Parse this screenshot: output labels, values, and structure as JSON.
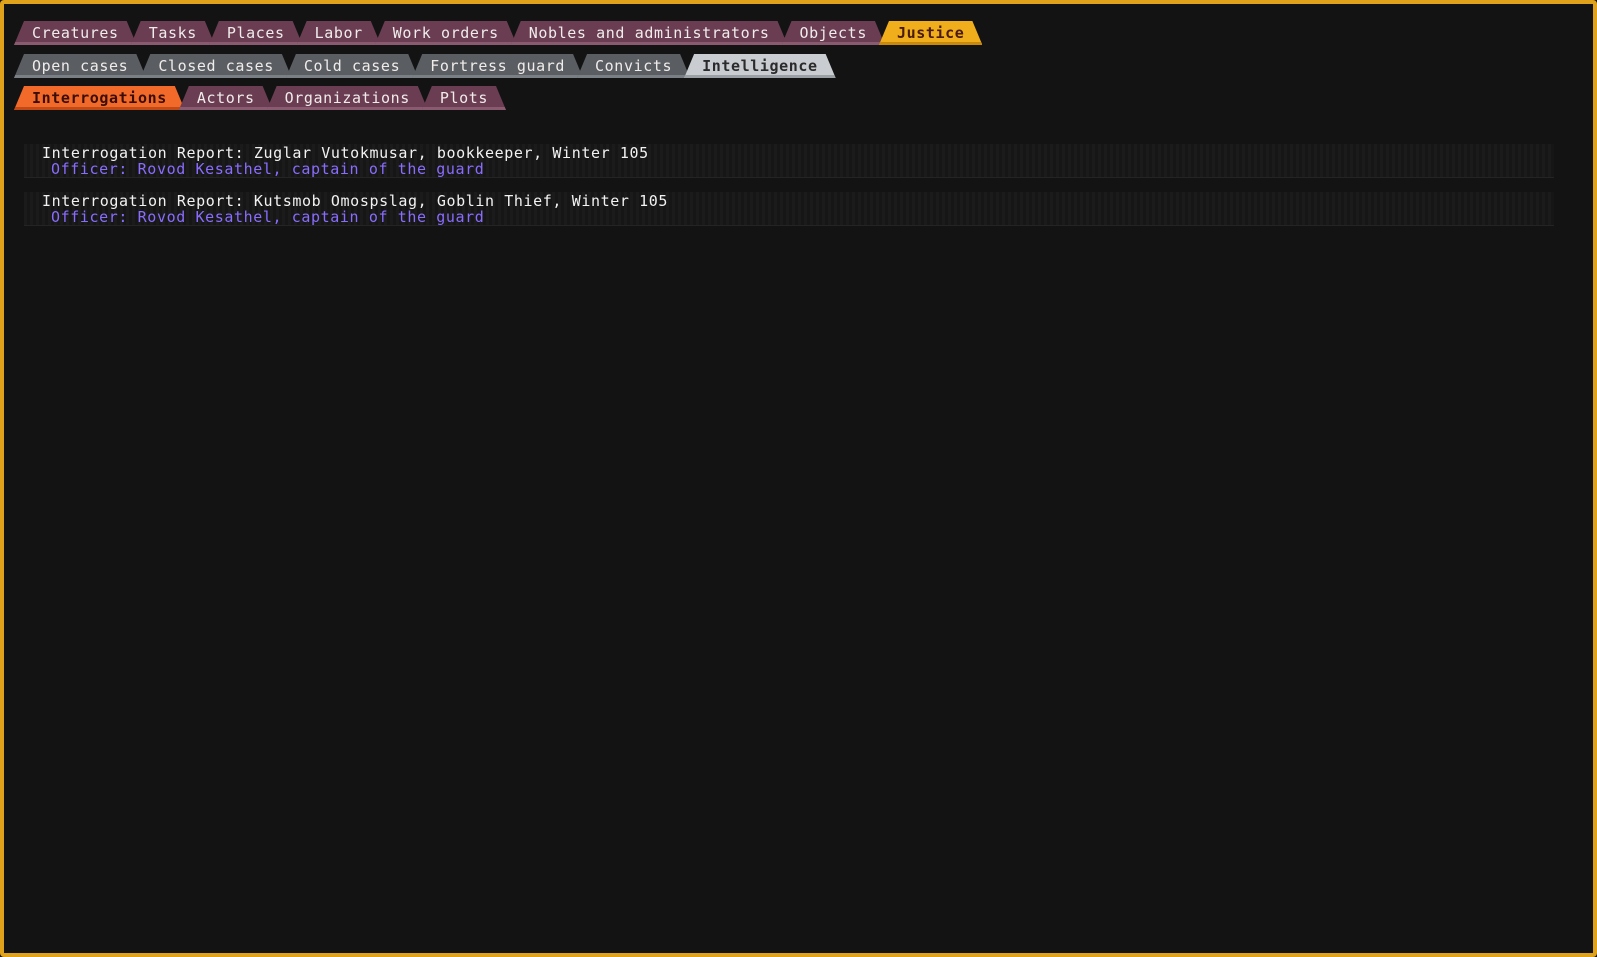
{
  "colors": {
    "frame": "#e0a21a",
    "background": "#131313",
    "main_tab": "#6a3d52",
    "main_tab_active": "#f0ad1c",
    "sub_tab": "#5a5e63",
    "sub_tab_active": "#c9cdd2",
    "third_tab_active": "#f26a2a",
    "report_title": "#f2f2f2",
    "officer_text": "#8a6cff"
  },
  "main_tabs": [
    {
      "label": "Creatures",
      "active": false
    },
    {
      "label": "Tasks",
      "active": false
    },
    {
      "label": "Places",
      "active": false
    },
    {
      "label": "Labor",
      "active": false
    },
    {
      "label": "Work orders",
      "active": false
    },
    {
      "label": "Nobles and administrators",
      "active": false
    },
    {
      "label": "Objects",
      "active": false
    },
    {
      "label": "Justice",
      "active": true
    }
  ],
  "justice_tabs": [
    {
      "label": "Open cases",
      "active": false
    },
    {
      "label": "Closed cases",
      "active": false
    },
    {
      "label": "Cold cases",
      "active": false
    },
    {
      "label": "Fortress guard",
      "active": false
    },
    {
      "label": "Convicts",
      "active": false
    },
    {
      "label": "Intelligence",
      "active": true
    }
  ],
  "intelligence_tabs": [
    {
      "label": "Interrogations",
      "active": true
    },
    {
      "label": "Actors",
      "active": false
    },
    {
      "label": "Organizations",
      "active": false
    },
    {
      "label": "Plots",
      "active": false
    }
  ],
  "reports": [
    {
      "title": "Interrogation Report: Zuglar Vutokmusar, bookkeeper, Winter 105",
      "officer": "Officer: Rovod Kesathel, captain of the guard"
    },
    {
      "title": "Interrogation Report: Kutsmob Omospslag, Goblin Thief, Winter 105",
      "officer": "Officer: Rovod Kesathel, captain of the guard"
    }
  ]
}
